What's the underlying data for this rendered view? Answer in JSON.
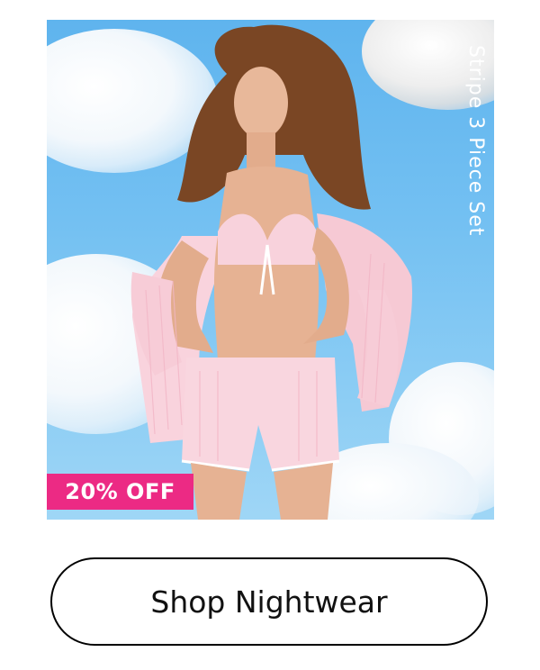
{
  "promo": {
    "product_name": "Stripe 3 Piece Set",
    "discount_badge": "20% OFF",
    "cta_label": "Shop Nightwear",
    "colors": {
      "sky": "#73c0f2",
      "badge": "#ec2a84",
      "garment_pink": "#f7cfd9"
    }
  }
}
